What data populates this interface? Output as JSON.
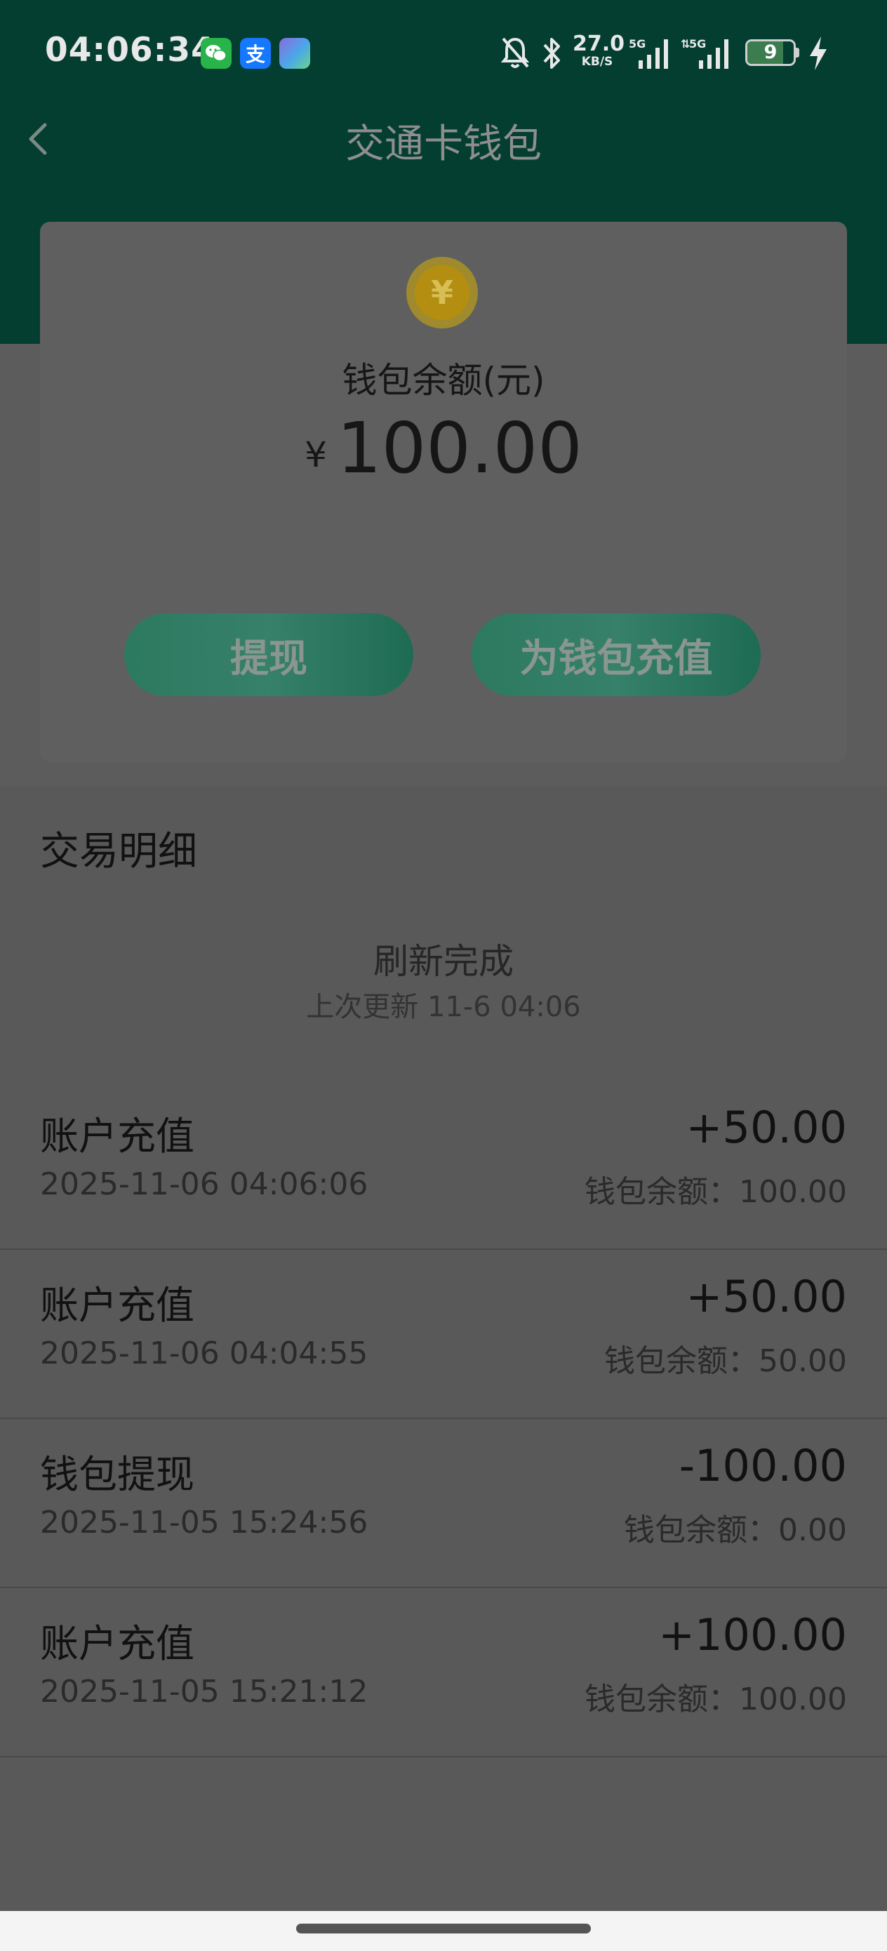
{
  "status_bar": {
    "time": "04:06:34",
    "alipay_glyph": "支",
    "net_speed_value": "27.0",
    "net_speed_unit": "KB/S",
    "signal1_label": "5G",
    "signal2_label": "5G",
    "battery": "9",
    "icons": [
      "wechat-icon",
      "alipay-icon",
      "gallery-icon",
      "mute-bell-icon",
      "bluetooth-icon",
      "signal-icon",
      "battery-icon",
      "charging-icon"
    ]
  },
  "header": {
    "title": "交通卡钱包",
    "back_icon": "chevron-left-icon"
  },
  "wallet": {
    "coin_glyph": "¥",
    "balance_label": "钱包余额(元)",
    "currency_symbol": "¥",
    "balance": "100.00",
    "withdraw_label": "提现",
    "recharge_label": "为钱包充值"
  },
  "transactions": {
    "section_title": "交易明细",
    "refresh_status": "刷新完成",
    "last_update": "上次更新 11-6 04:06",
    "items": [
      {
        "type": "账户充值",
        "date": "2025-11-06 04:06:06",
        "amount": "+50.00",
        "balance": "钱包余额：100.00"
      },
      {
        "type": "账户充值",
        "date": "2025-11-06 04:04:55",
        "amount": "+50.00",
        "balance": "钱包余额：50.00"
      },
      {
        "type": "钱包提现",
        "date": "2025-11-05 15:24:56",
        "amount": "-100.00",
        "balance": "钱包余额：0.00"
      },
      {
        "type": "账户充值",
        "date": "2025-11-05 15:21:12",
        "amount": "+100.00",
        "balance": "钱包余额：100.00"
      }
    ]
  },
  "colors": {
    "header_green": "#033e30",
    "button_green": "#2c7a60",
    "overlay_gray": "#595959"
  }
}
